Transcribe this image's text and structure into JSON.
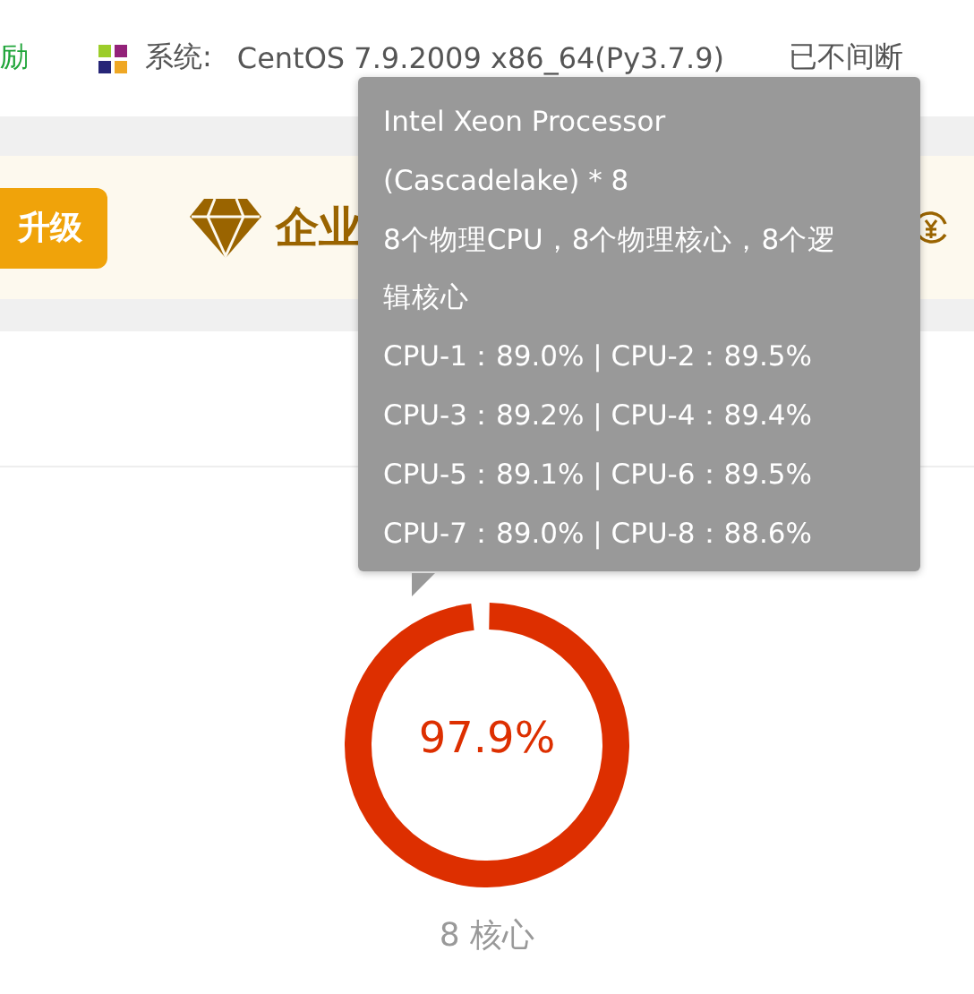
{
  "top_bar": {
    "reward_link": "励",
    "system_label": "系统:",
    "system_value": "CentOS 7.9.2009 x86_64(Py3.7.9)",
    "uptime_label": "已不间断"
  },
  "banner": {
    "upgrade_button": "升级",
    "edition_title": "企业"
  },
  "cpu_gauge": {
    "level": 0.979,
    "value": "97.9%",
    "cores": "8 核心"
  },
  "tooltip": {
    "lines": [
      "Intel Xeon Processor",
      "(Cascadelake) * 8",
      "8个物理CPU，8个物理核心，8个逻",
      "辑核心",
      "CPU-1：89.0% | CPU-2：89.5%",
      "CPU-3：89.2% | CPU-4：89.4%",
      "CPU-5：89.1% | CPU-6：89.5%",
      "CPU-7：89.0% | CPU-8：88.6%"
    ]
  }
}
